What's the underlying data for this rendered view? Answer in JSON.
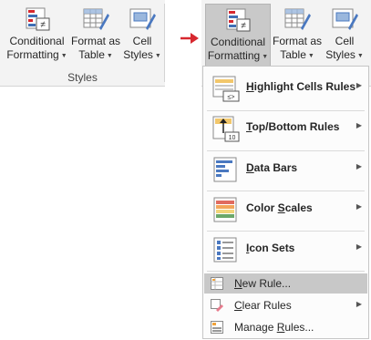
{
  "left_ribbon": {
    "conditional_formatting": {
      "line1": "Conditional",
      "line2": "Formatting"
    },
    "format_as_table": {
      "line1": "Format as",
      "line2": "Table"
    },
    "cell_styles": {
      "line1": "Cell",
      "line2": "Styles"
    },
    "group_label": "Styles"
  },
  "right_ribbon": {
    "conditional_formatting": {
      "line1": "Conditional",
      "line2": "Formatting"
    },
    "format_as_table": {
      "line1": "Format as",
      "line2": "Table"
    },
    "cell_styles": {
      "line1": "Cell",
      "line2": "Styles"
    }
  },
  "menu": {
    "highlight_cells_rules": {
      "pre": "",
      "key": "H",
      "post": "ighlight Cells Rules"
    },
    "top_bottom_rules": {
      "pre": "",
      "key": "T",
      "post": "op/Bottom Rules",
      "icon_badge": "10"
    },
    "data_bars": {
      "pre": "",
      "key": "D",
      "post": "ata Bars"
    },
    "color_scales": {
      "pre": "",
      "key": "S",
      "pre_full": "Color ",
      "post": "cales"
    },
    "icon_sets": {
      "pre": "",
      "key": "I",
      "post": "con Sets"
    },
    "new_rule": {
      "pre": "",
      "key": "N",
      "post": "ew Rule..."
    },
    "clear_rules": {
      "pre": "",
      "key": "C",
      "post": "lear Rules"
    },
    "manage_rules": {
      "pre": "Manage ",
      "key": "R",
      "post": "ules..."
    },
    "submenu_glyph": "▶",
    "highlight_icon_text": "≤>"
  },
  "colors": {
    "accent_red": "#d7282f",
    "selected_bg": "#c9c9c9",
    "hover_bg": "#c8c8c8",
    "ribbon_bg": "#f3f3f3"
  }
}
